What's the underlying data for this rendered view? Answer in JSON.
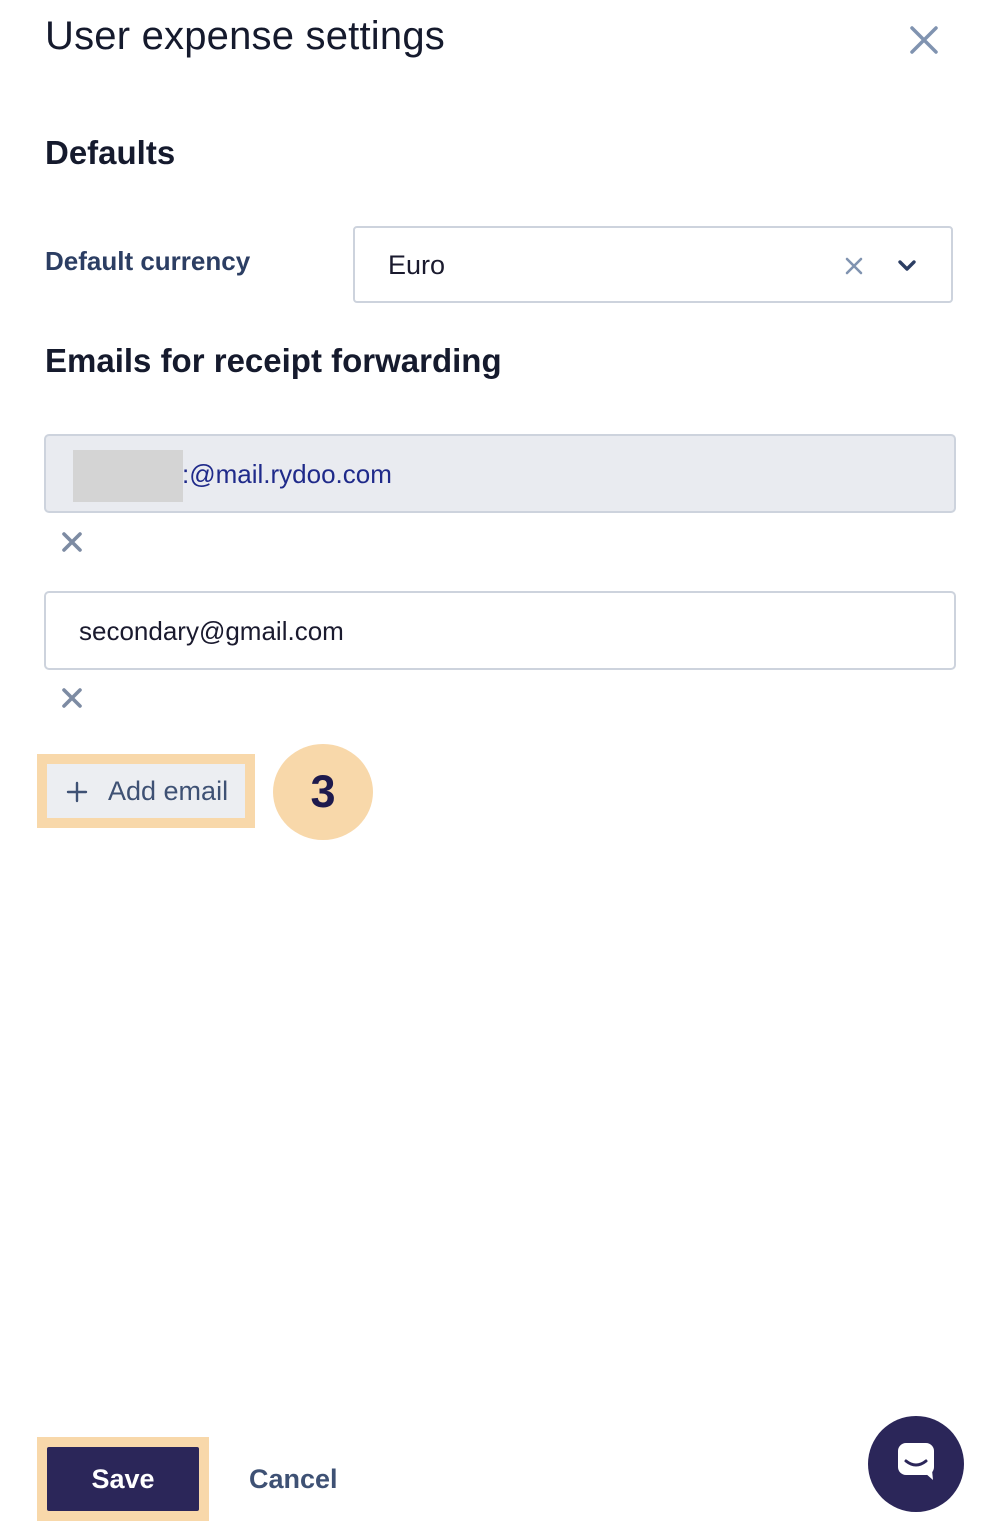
{
  "dialog": {
    "title": "User expense settings"
  },
  "defaults": {
    "heading": "Defaults",
    "currency_label": "Default currency",
    "currency_value": "Euro"
  },
  "emails": {
    "heading": "Emails for receipt forwarding",
    "items": [
      {
        "value": ":@mail.rydoo.com",
        "disabled": true,
        "prefix_redacted": true
      },
      {
        "value": "secondary@gmail.com",
        "disabled": false
      }
    ],
    "add_label": "Add email"
  },
  "annotation": {
    "step_number": "3",
    "highlight_color": "#f8d8aa"
  },
  "footer": {
    "save_label": "Save",
    "cancel_label": "Cancel"
  },
  "icons": {
    "close": "close-icon",
    "clear": "clear-icon",
    "chevron": "chevron-down-icon",
    "remove": "remove-email-icon",
    "plus": "plus-icon",
    "chat": "chat-icon"
  },
  "colors": {
    "primary": "#2b2659",
    "text_secondary": "#3e5174",
    "border": "#cdd3dd",
    "disabled_bg": "#e9ebf0",
    "link_text": "#1f2a8a"
  }
}
